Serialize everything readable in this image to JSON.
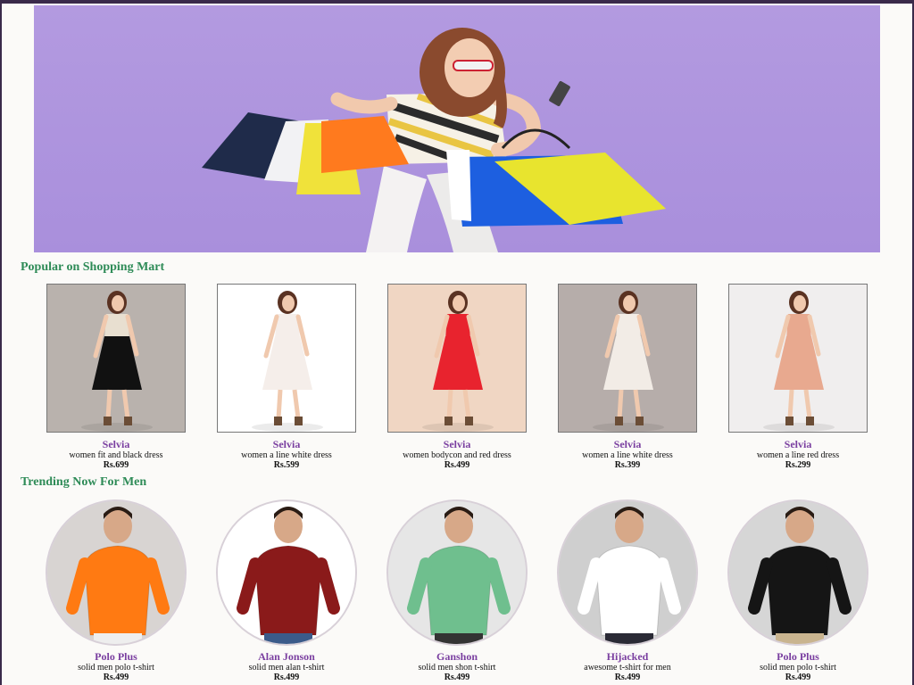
{
  "hero": {
    "banner": "shopping-woman-banner",
    "colors": {
      "background": "#a98fdc"
    }
  },
  "sections": {
    "popular_title": "Popular on Shopping Mart",
    "men_title": "Trending Now For Men"
  },
  "women": [
    {
      "brand": "Selvia",
      "desc": "women fit and black dress",
      "price": "Rs.699",
      "bg": "#b9b2ad",
      "dress": "#111111",
      "top": "#e8dfd0"
    },
    {
      "brand": "Selvia",
      "desc": "women a line white dress",
      "price": "Rs.599",
      "bg": "#ffffff",
      "dress": "#f5eeea",
      "top": "#f5eeea"
    },
    {
      "brand": "Selvia",
      "desc": "women bodycon and red dress",
      "price": "Rs.499",
      "bg": "#f0d6c3",
      "dress": "#e8232e",
      "top": "#e8232e"
    },
    {
      "brand": "Selvia",
      "desc": "women a line white dress",
      "price": "Rs.399",
      "bg": "#b6adaa",
      "dress": "#f2ece6",
      "top": "#f2ece6"
    },
    {
      "brand": "Selvia",
      "desc": "women a line red dress",
      "price": "Rs.299",
      "bg": "#f0eeee",
      "dress": "#e8a98f",
      "top": "#e8a98f"
    }
  ],
  "men": [
    {
      "brand": "Polo Plus",
      "desc": "solid men polo t-shirt",
      "price": "Rs.499",
      "bg": "#d8d4d2",
      "shirt": "#ff7a12",
      "pants": "#eeeeee"
    },
    {
      "brand": "Alan Jonson",
      "desc": "solid men alan t-shirt",
      "price": "Rs.499",
      "bg": "#ffffff",
      "shirt": "#8a1a1a",
      "pants": "#3b5b8a"
    },
    {
      "brand": "Ganshon",
      "desc": "solid men shon t-shirt",
      "price": "Rs.499",
      "bg": "#e6e6e6",
      "shirt": "#6fbf8e",
      "pants": "#333333"
    },
    {
      "brand": "Hijacked",
      "desc": "awesome t-shirt for men",
      "price": "Rs.499",
      "bg": "#cfcfcf",
      "shirt": "#ffffff",
      "pants": "#2a2a35"
    },
    {
      "brand": "Polo Plus",
      "desc": "solid men polo t-shirt",
      "price": "Rs.499",
      "bg": "#d6d6d6",
      "shirt": "#151515",
      "pants": "#c9b48f"
    }
  ]
}
